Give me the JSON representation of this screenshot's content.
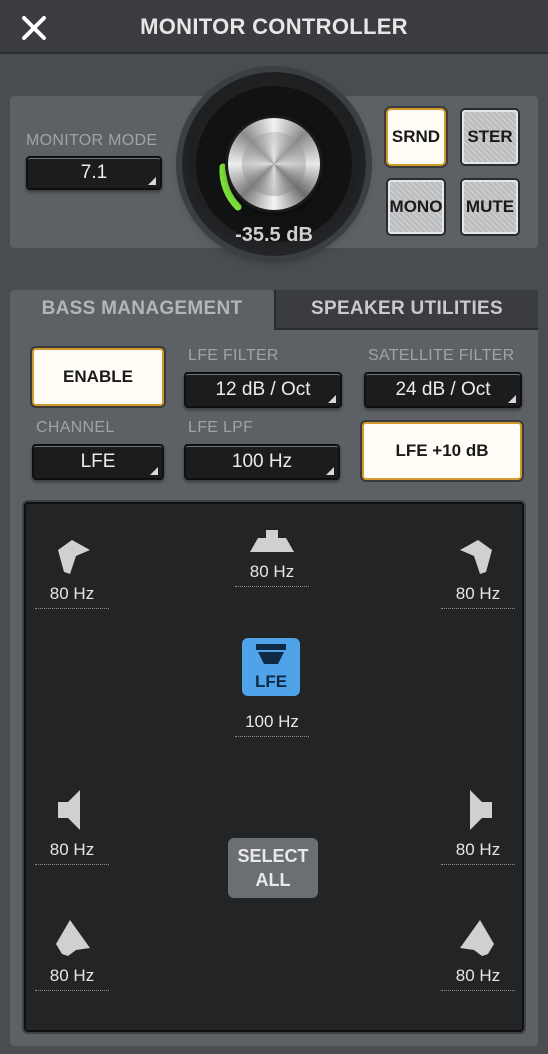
{
  "window": {
    "title": "MONITOR CONTROLLER",
    "close_icon": "close-icon"
  },
  "monitor": {
    "mode_label": "MONITOR MODE",
    "mode_value": "7.1",
    "volume_value": "-35.5 dB",
    "buttons": {
      "srnd": "SRND",
      "ster": "STER",
      "mono": "MONO",
      "mute": "MUTE"
    }
  },
  "tabs": {
    "bass": "BASS MANAGEMENT",
    "speaker": "SPEAKER UTILITIES"
  },
  "bass": {
    "enable": "ENABLE",
    "lfe_filter_label": "LFE FILTER",
    "lfe_filter_value": "12 dB / Oct",
    "satellite_filter_label": "SATELLITE FILTER",
    "satellite_filter_value": "24 dB / Oct",
    "channel_label": "CHANNEL",
    "channel_value": "LFE",
    "lfe_lpf_label": "LFE LPF",
    "lfe_lpf_value": "100 Hz",
    "lfe_boost": "LFE +10 dB"
  },
  "speakers": {
    "front_left": "80 Hz",
    "center": "80 Hz",
    "front_right": "80 Hz",
    "lfe_label": "LFE",
    "lfe": "100 Hz",
    "side_left": "80 Hz",
    "side_right": "80 Hz",
    "rear_left": "80 Hz",
    "rear_right": "80 Hz",
    "select_all": "SELECT ALL"
  },
  "colors": {
    "accent_blue": "#4fa3e8",
    "meter_green": "#7ee03a",
    "active_border": "#d09a2c"
  }
}
